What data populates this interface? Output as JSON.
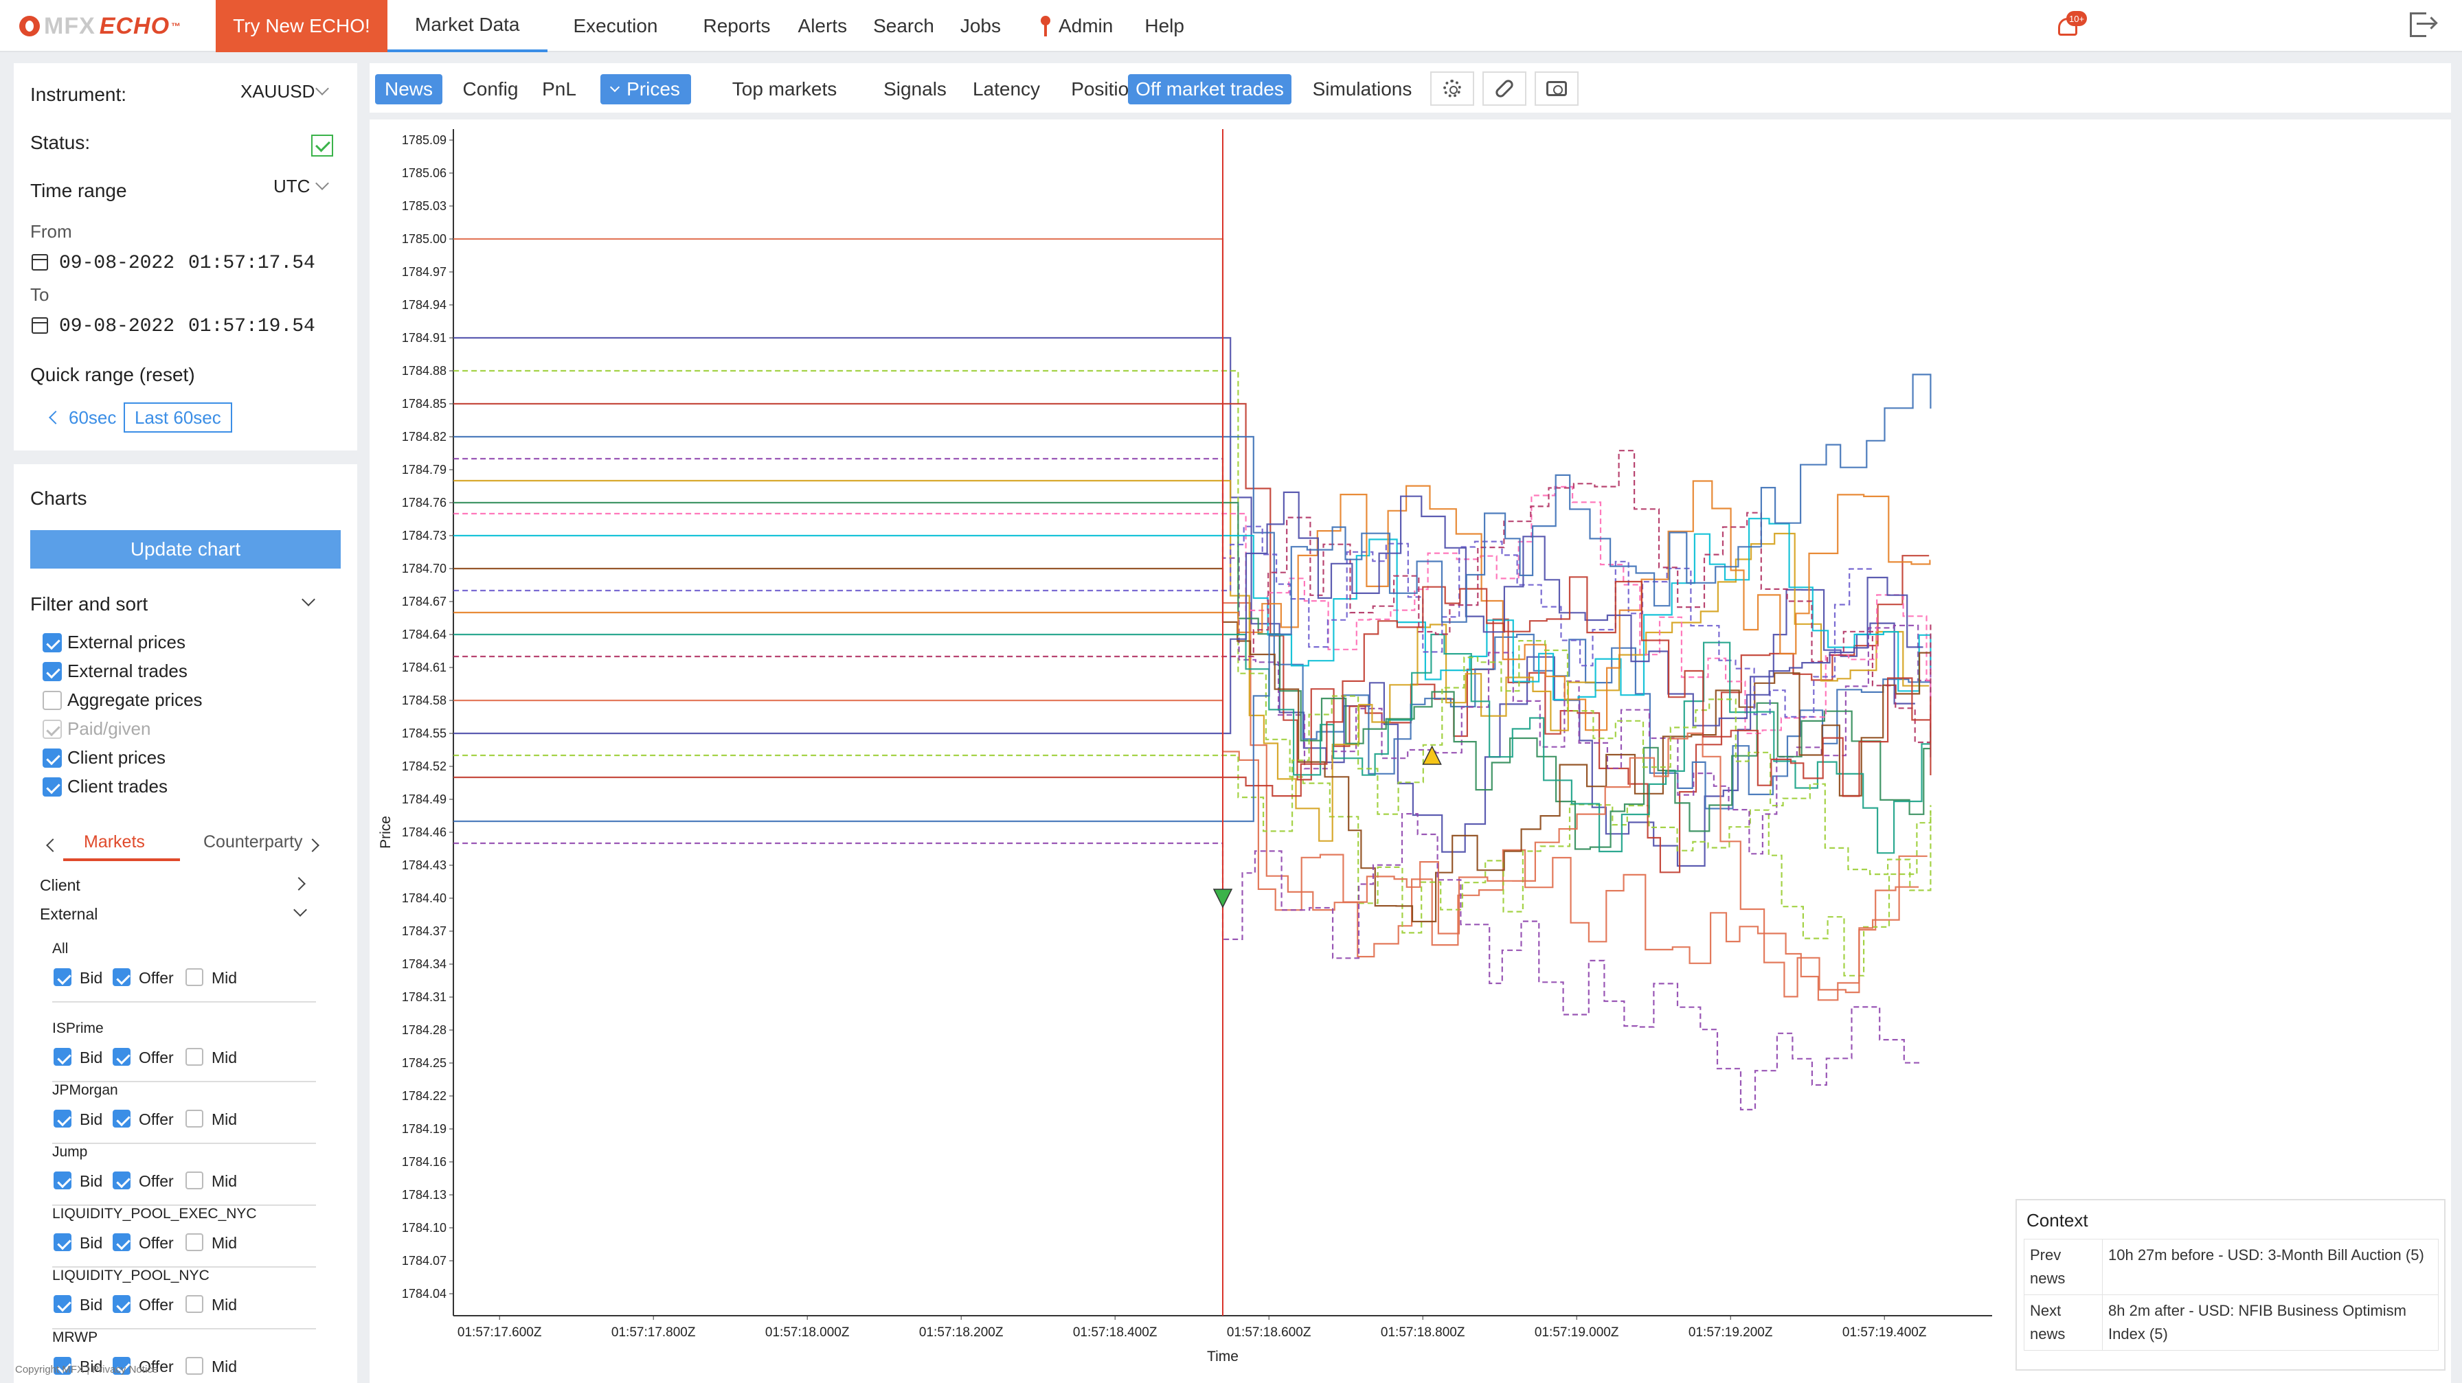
{
  "header": {
    "logo_prefix": "MFX",
    "logo_brand": "ECHO",
    "logo_tm": "™",
    "try_button": "Try New ECHO!",
    "nav": [
      "Market Data",
      "Execution",
      "Reports",
      "Alerts",
      "Search",
      "Jobs",
      "Admin",
      "Help"
    ],
    "active_nav": "Market Data",
    "notification_badge": "10+",
    "brand_color": "#e04a2b"
  },
  "filters": {
    "instrument_label": "Instrument:",
    "instrument_value": "XAUUSD",
    "status_label": "Status:",
    "status_checked": true,
    "time_range_label": "Time range",
    "timezone": "UTC",
    "from_label": "From",
    "from_date": "09-08-2022",
    "from_time": "01:57:17.54",
    "to_label": "To",
    "to_date": "09-08-2022",
    "to_time": "01:57:19.54",
    "quick_range_label": "Quick range (reset)",
    "prev_60_label": "60sec",
    "last_60_label": "Last 60sec"
  },
  "charts_panel": {
    "title": "Charts",
    "update_button": "Update chart",
    "filter_sort_label": "Filter and sort",
    "options": [
      {
        "label": "External prices",
        "checked": true,
        "disabled": false
      },
      {
        "label": "External trades",
        "checked": true,
        "disabled": false
      },
      {
        "label": "Aggregate prices",
        "checked": false,
        "disabled": false
      },
      {
        "label": "Paid/given",
        "checked": true,
        "disabled": true
      },
      {
        "label": "Client prices",
        "checked": true,
        "disabled": false
      },
      {
        "label": "Client trades",
        "checked": true,
        "disabled": false
      }
    ],
    "subtab_markets": "Markets",
    "subtab_counterparty": "Counterparty",
    "client_label": "Client",
    "external_label": "External",
    "bid_label": "Bid",
    "offer_label": "Offer",
    "mid_label": "Mid",
    "markets": [
      {
        "name": "All",
        "bid": true,
        "offer": true,
        "mid": false
      },
      {
        "name": "ISPrime",
        "bid": true,
        "offer": true,
        "mid": false
      },
      {
        "name": "JPMorgan",
        "bid": true,
        "offer": true,
        "mid": false
      },
      {
        "name": "Jump",
        "bid": true,
        "offer": true,
        "mid": false
      },
      {
        "name": "LIQUIDITY_POOL_EXEC_NYC",
        "bid": true,
        "offer": true,
        "mid": false
      },
      {
        "name": "LIQUIDITY_POOL_NYC",
        "bid": true,
        "offer": true,
        "mid": false
      },
      {
        "name": "MRWP",
        "bid": true,
        "offer": true,
        "mid": false
      }
    ],
    "copyright": "Copyright MFX | Privacy Notice"
  },
  "main_tabs": [
    {
      "label": "News",
      "active": true
    },
    {
      "label": "Config",
      "active": false
    },
    {
      "label": "PnL",
      "active": false
    },
    {
      "label": "Prices",
      "active": true,
      "expanded": true
    },
    {
      "label": "Top markets",
      "active": false
    },
    {
      "label": "Signals",
      "active": false
    },
    {
      "label": "Latency",
      "active": false
    },
    {
      "label": "Positions",
      "active": false
    },
    {
      "label": "Off market trades",
      "active": true
    },
    {
      "label": "Simulations",
      "active": false
    }
  ],
  "toolbar_icons": [
    "gear-icon",
    "link-icon",
    "camera-icon"
  ],
  "chart_data": {
    "type": "line",
    "title": "",
    "xlabel": "Time",
    "ylabel": "Price",
    "x_ticks": [
      "01:57:17.600Z",
      "01:57:17.800Z",
      "01:57:18.000Z",
      "01:57:18.200Z",
      "01:57:18.400Z",
      "01:57:18.600Z",
      "01:57:18.800Z",
      "01:57:19.000Z",
      "01:57:19.200Z",
      "01:57:19.400Z"
    ],
    "y_ticks": [
      "1785.09",
      "1785.06",
      "1785.03",
      "1785.00",
      "1784.97",
      "1784.94",
      "1784.91",
      "1784.88",
      "1784.85",
      "1784.82",
      "1784.79",
      "1784.76",
      "1784.73",
      "1784.70",
      "1784.67",
      "1784.64",
      "1784.61",
      "1784.58",
      "1784.55",
      "1784.52",
      "1784.49",
      "1784.46",
      "1784.43",
      "1784.40",
      "1784.37",
      "1784.34",
      "1784.31",
      "1784.28",
      "1784.25",
      "1784.22",
      "1784.19",
      "1784.16",
      "1784.13",
      "1784.10",
      "1784.07",
      "1784.04"
    ],
    "xlim": [
      "01:57:17.540Z",
      "01:57:19.540Z"
    ],
    "ylim": [
      1784.02,
      1785.1
    ],
    "event_time": "01:57:18.540Z",
    "markers": [
      {
        "shape": "triangle-down",
        "x": "01:57:18.540Z",
        "y": 1784.4,
        "color": "#3bb34a"
      },
      {
        "shape": "triangle-up",
        "x": "01:57:18.812Z",
        "y": 1784.53,
        "color": "#f5c518"
      }
    ],
    "series_colors": [
      "#e06c4a",
      "#4a4aa8",
      "#9acd32",
      "#c0392b",
      "#3b6fb6",
      "#8e44ad",
      "#d4a017",
      "#2e8b57",
      "#ff69b4",
      "#00bcd4",
      "#8b4513",
      "#6a5acd",
      "#e67e22",
      "#16a085",
      "#b03060"
    ],
    "grid": false,
    "legend": "none"
  },
  "context": {
    "title": "Context",
    "rows": [
      {
        "label": "Prev news",
        "value": "10h 27m before - USD: 3-Month Bill Auction (5)"
      },
      {
        "label": "Next news",
        "value": "8h 2m after - USD: NFIB Business Optimism Index (5)"
      }
    ]
  }
}
